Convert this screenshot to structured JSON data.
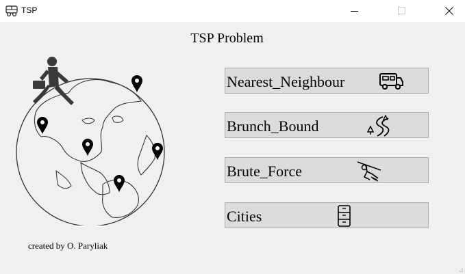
{
  "window": {
    "title": "TSP",
    "icon": "vehicle-icon",
    "controls": [
      "minimize",
      "maximize",
      "close"
    ]
  },
  "main": {
    "heading": "TSP Problem",
    "buttons": [
      {
        "label": "Nearest_Neighbour",
        "icon": "camper-van-icon"
      },
      {
        "label": "Brunch_Bound",
        "icon": "winding-road-icon"
      },
      {
        "label": "Brute_Force",
        "icon": "zipline-icon"
      },
      {
        "label": "Cities",
        "icon": "file-cabinet-icon"
      }
    ],
    "credit": "created by O. Paryliak",
    "illustration": "globe-with-running-man-and-map-pins"
  }
}
